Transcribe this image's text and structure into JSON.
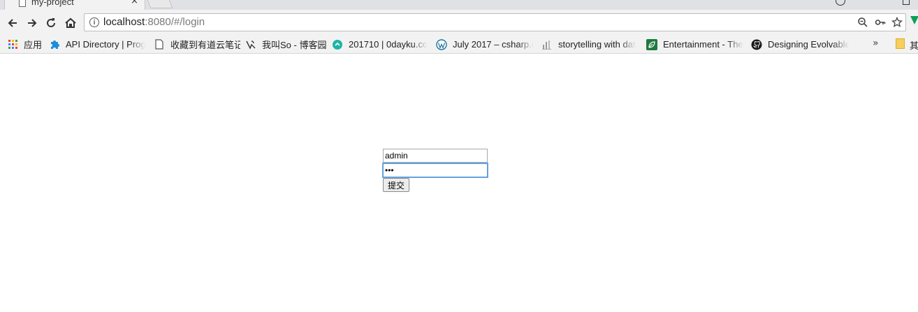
{
  "browser": {
    "tab_title": "my-project",
    "tab_close": "×",
    "url_host": "localhost",
    "url_rest": ":8080/#/login",
    "info_glyph": "i"
  },
  "bookmarks": {
    "items": [
      {
        "label": "应用",
        "icon": "apps-grid-icon"
      },
      {
        "label": "API Directory | Prog",
        "icon": "puzzle-icon"
      },
      {
        "label": "收藏到有道云笔记",
        "icon": "page-icon"
      },
      {
        "label": "我叫So - 博客园",
        "icon": "cnblogs-icon"
      },
      {
        "label": "201710 | 0dayku.co",
        "icon": "teal-circle-icon"
      },
      {
        "label": "July 2017 – csharp.c",
        "icon": "wordpress-icon"
      },
      {
        "label": "storytelling with dat",
        "icon": "bar-chart-icon"
      },
      {
        "label": "Entertainment - The",
        "icon": "leaf-icon"
      },
      {
        "label": "Designing Evolvable",
        "icon": "github-icon"
      }
    ],
    "overflow_chevron": "»",
    "folder_label": "其"
  },
  "login": {
    "username_value": "admin",
    "password_value": "•••",
    "submit_label": "提交"
  },
  "colors": {
    "chrome_bg": "#f2f2f2",
    "focus_ring": "#5b9dd9",
    "apps_grid": [
      "#e94235",
      "#fbbc04",
      "#34a853",
      "#4285f4",
      "#e94235",
      "#fbbc04",
      "#34a853",
      "#4285f4",
      "#e94235"
    ]
  }
}
